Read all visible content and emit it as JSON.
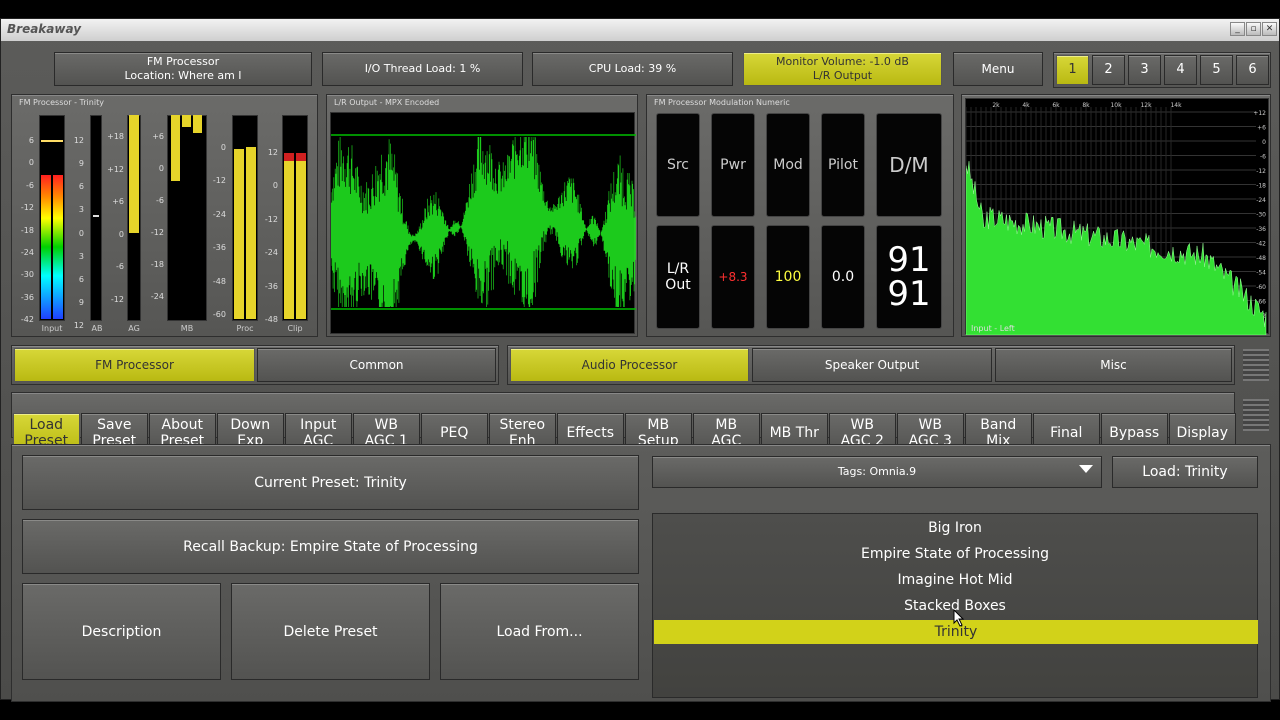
{
  "window": {
    "title": "Breakaway",
    "controls": [
      "_",
      "▫",
      "✕"
    ]
  },
  "header": {
    "fm_processor": {
      "line1": "FM Processor",
      "line2": "Location: Where am I"
    },
    "io_load": "I/O Thread Load: 1 %",
    "cpu_load": "CPU Load: 39 %",
    "monitor": {
      "line1": "Monitor Volume: -1.0 dB",
      "line2": "L/R Output"
    },
    "menu": "Menu",
    "presets": [
      "1",
      "2",
      "3",
      "4",
      "5",
      "6"
    ],
    "selected_preset": "1"
  },
  "meters": {
    "title": "FM Processor - Trinity",
    "input_ticks": [
      "6",
      "0",
      "-6",
      "-12",
      "-18",
      "-24",
      "-30",
      "-36",
      "-42"
    ],
    "ab_ticks": [
      "12",
      "9",
      "6",
      "3",
      "0",
      "3",
      "6",
      "9",
      "12"
    ],
    "ag_ticks": [
      "+18",
      "+12",
      "+6",
      "0",
      "-6",
      "-12"
    ],
    "mb_ticks": [
      "+6",
      "0",
      "-6",
      "-12",
      "-18",
      "-24"
    ],
    "proc_ticks": [
      "0",
      "-12",
      "-24",
      "-36",
      "-48",
      "-60"
    ],
    "clip_ticks": [
      "12",
      "0",
      "-12",
      "-24",
      "-36",
      "-48"
    ],
    "labels": [
      "Input",
      "AB",
      "AG",
      "MB",
      "Proc",
      "Clip"
    ]
  },
  "scope": {
    "title": "L/R Output - MPX Encoded"
  },
  "modulation": {
    "title": "FM Processor Modulation Numeric",
    "headers": [
      "Src",
      "Pwr",
      "Mod",
      "Pilot",
      "D/M"
    ],
    "src_value": "L/R\nOut",
    "pwr_value": "+8.3",
    "mod_value": "100",
    "pilot_value": "0.0",
    "dm_top": "91",
    "dm_bottom": "91",
    "colors": {
      "pwr": "#ff3030",
      "mod": "#ffff40",
      "pilot": "#ffffff"
    }
  },
  "spectrum": {
    "label": "Input - Left",
    "freq_ticks": [
      "2k",
      "4k",
      "6k",
      "8k",
      "10k",
      "12k",
      "14k"
    ],
    "db_ticks": [
      "+12",
      "+6",
      "0",
      "-6",
      "-12",
      "-18",
      "-24",
      "-30",
      "-36",
      "-42",
      "-48",
      "-54",
      "-60",
      "-66",
      "-72"
    ]
  },
  "section_tabs": {
    "left": [
      {
        "label": "FM Processor",
        "selected": true
      },
      {
        "label": "Common",
        "selected": false
      }
    ],
    "right": [
      {
        "label": "Audio Processor",
        "selected": true
      },
      {
        "label": "Speaker Output",
        "selected": false
      },
      {
        "label": "Misc",
        "selected": false
      }
    ]
  },
  "nav": [
    {
      "label": "Load\nPreset",
      "selected": true
    },
    {
      "label": "Save\nPreset"
    },
    {
      "label": "About\nPreset"
    },
    {
      "label": "Down\nExp"
    },
    {
      "label": "Input\nAGC"
    },
    {
      "label": "WB\nAGC 1"
    },
    {
      "label": "PEQ"
    },
    {
      "label": "Stereo\nEnh"
    },
    {
      "label": "Effects"
    },
    {
      "label": "MB\nSetup"
    },
    {
      "label": "MB\nAGC"
    },
    {
      "label": "MB Thr"
    },
    {
      "label": "WB\nAGC 2"
    },
    {
      "label": "WB\nAGC 3"
    },
    {
      "label": "Band\nMix"
    },
    {
      "label": "Final"
    },
    {
      "label": "Bypass"
    },
    {
      "label": "Display"
    }
  ],
  "preset_panel": {
    "current": "Current Preset: Trinity",
    "recall": "Recall Backup: Empire State of Processing",
    "description": "Description",
    "delete": "Delete Preset",
    "load_from": "Load From...",
    "tags": "Tags: Omnia.9",
    "load": "Load: Trinity",
    "list": [
      "Big Iron",
      "Empire State of Processing",
      "Imagine Hot Mid",
      "Stacked Boxes",
      "Trinity"
    ],
    "selected": "Trinity"
  },
  "accent": "#cccc22"
}
